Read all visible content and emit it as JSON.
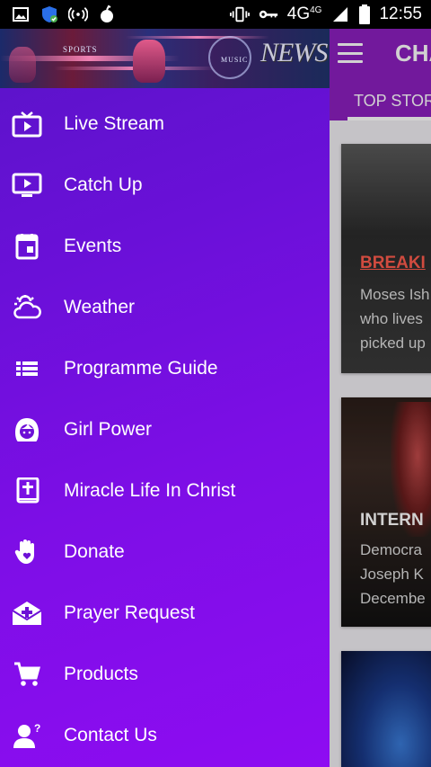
{
  "status_bar": {
    "network": "4G",
    "network_small": "4G",
    "time": "12:55",
    "icons": [
      "image-icon",
      "security-shield-icon",
      "broadcast-icon",
      "bomb-icon",
      "vibrate-icon",
      "key-icon",
      "signal-icon",
      "battery-icon"
    ]
  },
  "drawer": {
    "banner": {
      "sports_label": "SPORTS",
      "music_label": "MUSIC",
      "news_label": "NEWS"
    },
    "items": [
      {
        "label": "Live Stream",
        "icon": "tv-play-icon"
      },
      {
        "label": "Catch Up",
        "icon": "monitor-play-icon"
      },
      {
        "label": "Events",
        "icon": "calendar-icon"
      },
      {
        "label": "Weather",
        "icon": "weather-icon"
      },
      {
        "label": "Programme Guide",
        "icon": "list-icon"
      },
      {
        "label": "Girl Power",
        "icon": "woman-icon"
      },
      {
        "label": "Miracle Life In Christ",
        "icon": "bible-icon"
      },
      {
        "label": "Donate",
        "icon": "hand-heart-icon"
      },
      {
        "label": "Prayer Request",
        "icon": "envelope-cross-icon"
      },
      {
        "label": "Products",
        "icon": "cart-icon"
      },
      {
        "label": "Contact Us",
        "icon": "person-question-icon"
      }
    ]
  },
  "app": {
    "title": "CHA",
    "tab": "TOP STOR",
    "cards": [
      {
        "heading": "BREAKI",
        "lines": [
          "Moses Ish",
          "who lives",
          "picked up"
        ]
      },
      {
        "heading": "INTERN",
        "lines": [
          "Democra",
          "Joseph K",
          "Decembe"
        ]
      }
    ]
  },
  "colors": {
    "app_bar": "#8b1fbf",
    "drawer_gradient_start": "#5a14c8",
    "drawer_gradient_end": "#8e0cf2",
    "breaking_heading": "#ff5c4d"
  }
}
